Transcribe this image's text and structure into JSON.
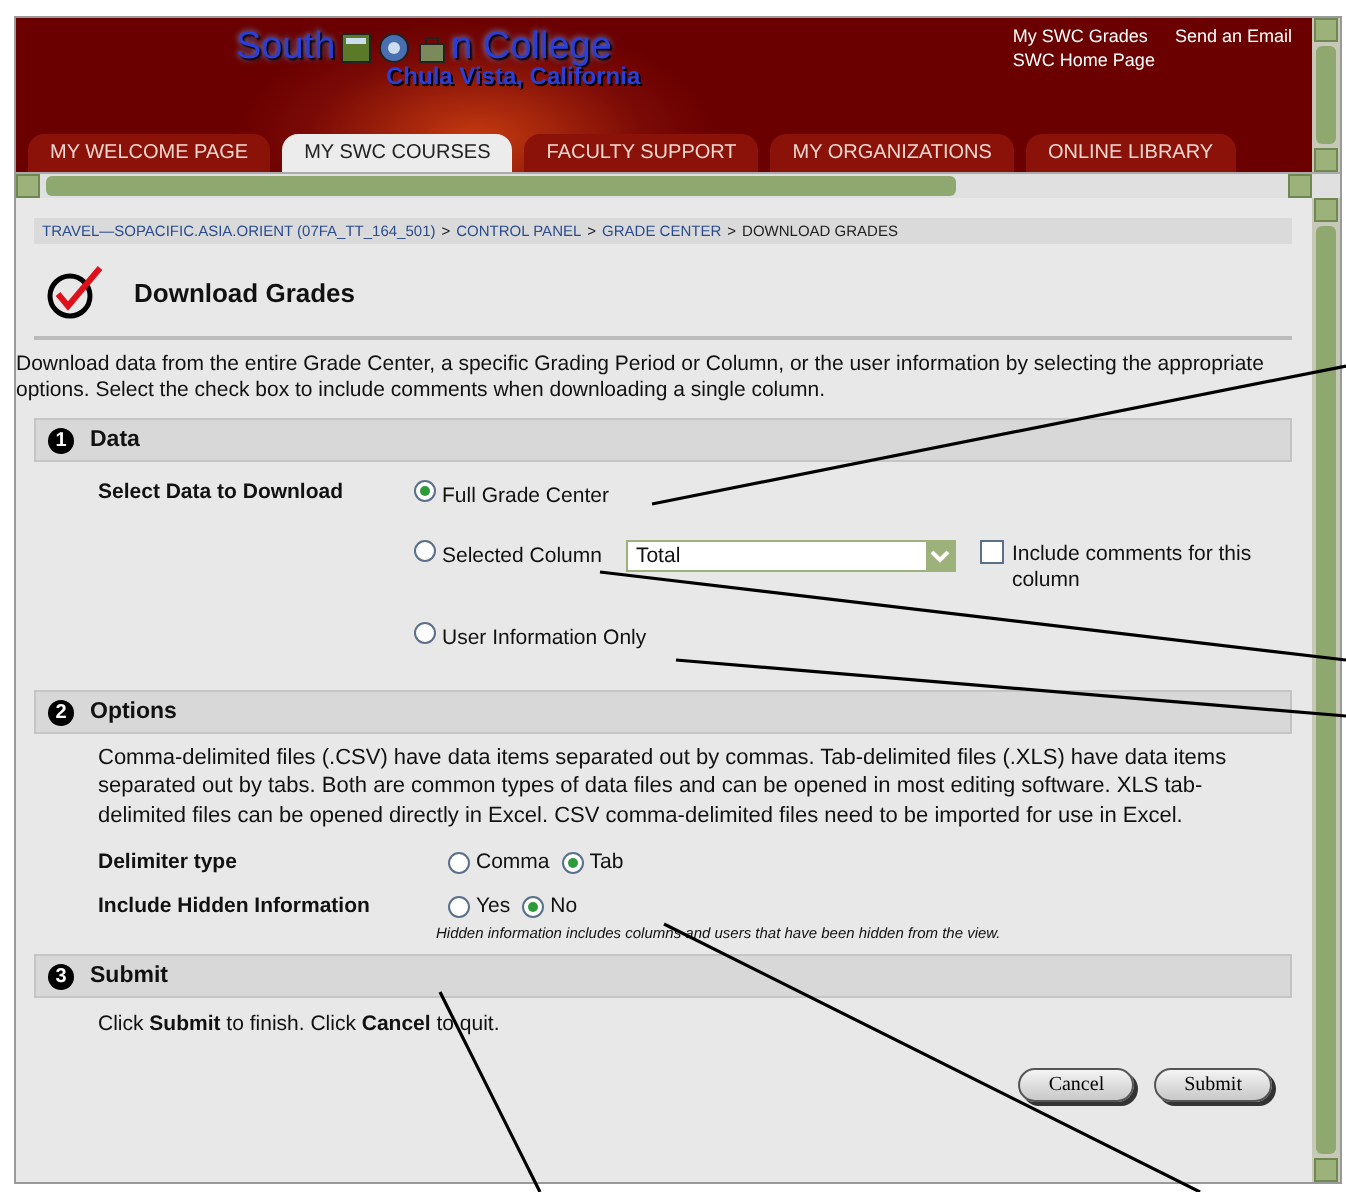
{
  "header": {
    "logo_title_start": "South",
    "logo_title_end": "n College",
    "logo_subtitle": "Chula Vista, California",
    "links": [
      "My SWC Grades",
      "Send an Email",
      "SWC Home Page"
    ]
  },
  "tabs": [
    {
      "label": "MY WELCOME PAGE",
      "selected": false
    },
    {
      "label": "MY SWC COURSES",
      "selected": true
    },
    {
      "label": "FACULTY SUPPORT",
      "selected": false
    },
    {
      "label": "MY ORGANIZATIONS",
      "selected": false
    },
    {
      "label": "ONLINE LIBRARY",
      "selected": false
    }
  ],
  "breadcrumb_separator": ">",
  "breadcrumb": [
    {
      "label": "TRAVEL—SOPACIFIC.ASIA.ORIENT (07FA_TT_164_501)",
      "kind": "link"
    },
    {
      "label": "CONTROL PANEL",
      "kind": "link"
    },
    {
      "label": "GRADE CENTER",
      "kind": "link"
    },
    {
      "label": "DOWNLOAD GRADES",
      "kind": "current"
    }
  ],
  "page_title": "Download Grades",
  "intro": "Download data from the entire Grade Center, a specific Grading Period or Column, or the user information by selecting the appropriate options. Select the check box to include comments when downloading a single column.",
  "data_section": {
    "number": "1",
    "title": "Data",
    "label": "Select Data to Download",
    "options": [
      {
        "label": "Full Grade Center",
        "selected": true
      },
      {
        "label": "Selected Column",
        "selected": false,
        "dropdown": "Total",
        "checkbox": {
          "label": "Include comments for this column",
          "checked": false
        }
      },
      {
        "label": "User Information Only",
        "selected": false
      }
    ]
  },
  "options_section": {
    "number": "2",
    "title": "Options",
    "description": "Comma-delimited files (.CSV) have data items separated out by commas. Tab-delimited files (.XLS) have data items separated out by tabs. Both are common types of data files and can be opened in most editing software. XLS tab-delimited files can be opened directly in Excel. CSV comma-delimited files need to be imported for use in Excel.",
    "fields": [
      {
        "label": "Delimiter type",
        "options": [
          {
            "label": "Comma",
            "selected": false
          },
          {
            "label": "Tab",
            "selected": true
          }
        ]
      },
      {
        "label": "Include Hidden Information",
        "options": [
          {
            "label": "Yes",
            "selected": false
          },
          {
            "label": "No",
            "selected": true
          }
        ],
        "note": "Hidden information includes columns and users that have been hidden from the view."
      }
    ]
  },
  "submit_section": {
    "number": "3",
    "title": "Submit",
    "instruction": "Click **Submit** to finish. Click **Cancel** to quit.",
    "buttons": [
      "Cancel",
      "Submit"
    ]
  }
}
